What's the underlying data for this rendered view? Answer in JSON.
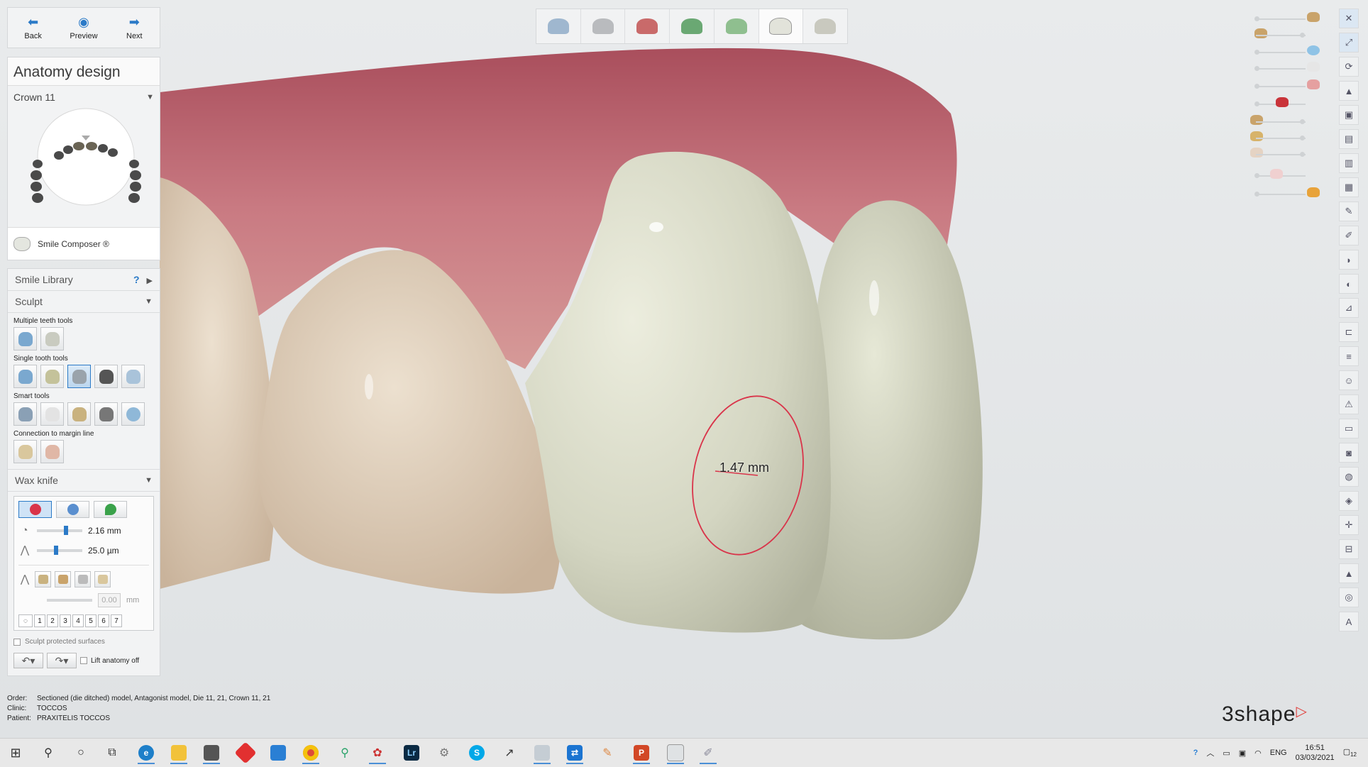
{
  "nav": {
    "back": "Back",
    "preview": "Preview",
    "next": "Next"
  },
  "design": {
    "title": "Anatomy design",
    "crown": "Crown 11",
    "smile_composer": "Smile Composer ®"
  },
  "tools": {
    "smile_library": "Smile Library",
    "help": "?",
    "sculpt": "Sculpt",
    "multiple_teeth": "Multiple teeth tools",
    "single_tooth": "Single tooth tools",
    "smart_tools": "Smart tools",
    "connection": "Connection to margin line",
    "wax_knife": "Wax knife",
    "size_value": "2.16 mm",
    "strength_value": "25.0 µm",
    "offset_value": "0.00",
    "offset_unit": "mm",
    "numbers": [
      "1",
      "2",
      "3",
      "4",
      "5",
      "6",
      "7"
    ],
    "sculpt_protected": "Sculpt protected surfaces",
    "lift_anatomy": "Lift anatomy off"
  },
  "measurement": "1.47 mm",
  "order": {
    "order_key": "Order:",
    "order_val": "Sectioned (die ditched) model, Antagonist model, Die 11, 21, Crown 11, 21",
    "clinic_key": "Clinic:",
    "clinic_val": "TOCCOS",
    "patient_key": "Patient:",
    "patient_val": "PRAXITELIS TOCCOS"
  },
  "logo": "3shape",
  "taskbar": {
    "lang": "ENG",
    "time": "16:51",
    "date": "03/03/2021",
    "notif_count": "12",
    "apps": [
      "start",
      "search",
      "cortana",
      "task-view",
      "edge",
      "file-explorer",
      "camera",
      "app-red",
      "app-blue-doc",
      "chrome",
      "magnifier",
      "dental-app",
      "lightroom",
      "settings",
      "skype",
      "snip",
      "dental-scan",
      "teamviewer",
      "paint",
      "powerpoint",
      "3shape-a",
      "3shape-b"
    ]
  },
  "colors": {
    "accent": "#2b7ac7",
    "gum": "#c46d78",
    "crown": "#d6d8c5",
    "circle": "#d9344a",
    "logo_mark": "#e0403c"
  }
}
